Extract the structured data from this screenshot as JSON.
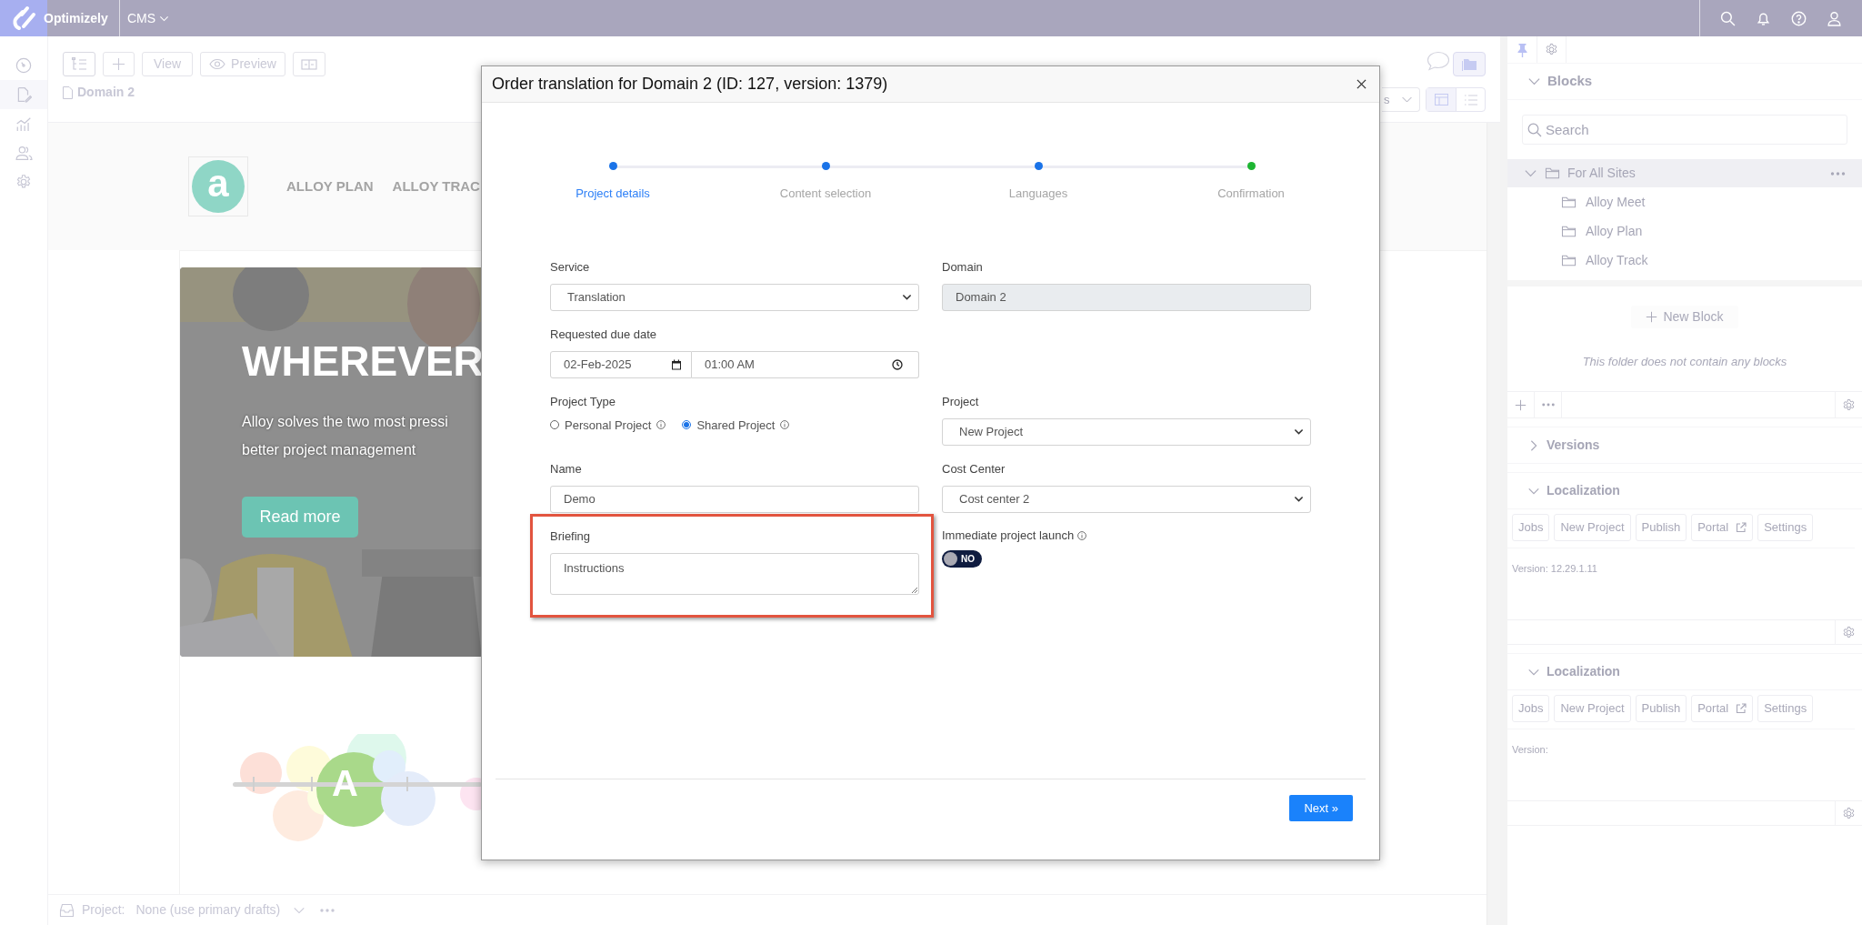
{
  "top_bar": {
    "brand": "Optimizely",
    "product": "CMS"
  },
  "toolbar": {
    "view": "View",
    "preview": "Preview",
    "page_title": "Domain 2",
    "view_dropdown": "s"
  },
  "preview": {
    "logo_letter": "a",
    "nav": [
      "ALLOY PLAN",
      "ALLOY TRAC"
    ],
    "hero": {
      "kind": "picture",
      "heading": "WHEREVER",
      "text_lines": [
        "Alloy solves the two most pressi",
        "better project management"
      ],
      "button": "Read more"
    },
    "brand_letter": "A"
  },
  "bottom_bar": {
    "label": "Project:",
    "value": "None (use primary drafts)"
  },
  "right_panel": {
    "blocks": {
      "title": "Blocks",
      "expanded": true,
      "search_placeholder": "Search",
      "tree": [
        {
          "label": "For All Sites",
          "expanded": true,
          "selected": true,
          "children": [
            {
              "label": "Alloy Meet",
              "selected": false
            },
            {
              "label": "Alloy Plan",
              "selected": false
            },
            {
              "label": "Alloy Track",
              "selected": false
            }
          ]
        }
      ],
      "new_block": "New Block",
      "empty_message": "This folder does not contain any blocks"
    },
    "sections": [
      {
        "kind": "versions",
        "title": "Versions",
        "expanded": false
      },
      {
        "kind": "localization",
        "title": "Localization",
        "expanded": true,
        "buttons": [
          "Jobs",
          "New Project",
          "Publish",
          "Portal",
          "Settings"
        ],
        "version": "Version: 12.29.1.11"
      },
      {
        "kind": "localization",
        "title": "Localization",
        "expanded": true,
        "buttons": [
          "Jobs",
          "New Project",
          "Publish",
          "Portal",
          "Settings"
        ],
        "version": "Version:"
      }
    ]
  },
  "modal": {
    "title": "Order translation for Domain 2 (ID: 127, version: 1379)",
    "steps": [
      {
        "label": "Project details",
        "selected": true,
        "color": "#1a73e8"
      },
      {
        "label": "Content selection",
        "selected": false,
        "color": "#1a73e8"
      },
      {
        "label": "Languages",
        "selected": false,
        "color": "#1a73e8"
      },
      {
        "label": "Confirmation",
        "selected": false,
        "color": "#1db532"
      }
    ],
    "service": {
      "label": "Service",
      "value": "Translation"
    },
    "domain": {
      "label": "Domain",
      "value": "Domain 2",
      "disabled": true
    },
    "due_date": {
      "label": "Requested due date",
      "date": "02-Feb-2025",
      "time": "01:00 AM"
    },
    "project_type": {
      "label": "Project Type",
      "options": [
        {
          "label": "Personal Project",
          "selected": false
        },
        {
          "label": "Shared Project",
          "selected": true
        }
      ]
    },
    "project": {
      "label": "Project",
      "value": "New Project"
    },
    "name": {
      "label": "Name",
      "value": "Demo"
    },
    "cost_center": {
      "label": "Cost Center",
      "value": "Cost center 2"
    },
    "briefing": {
      "label": "Briefing",
      "value": "Instructions",
      "highlighted": true
    },
    "immediate_launch": {
      "label": "Immediate project launch",
      "on": false,
      "state_text": "NO"
    },
    "next_button": "Next »"
  }
}
